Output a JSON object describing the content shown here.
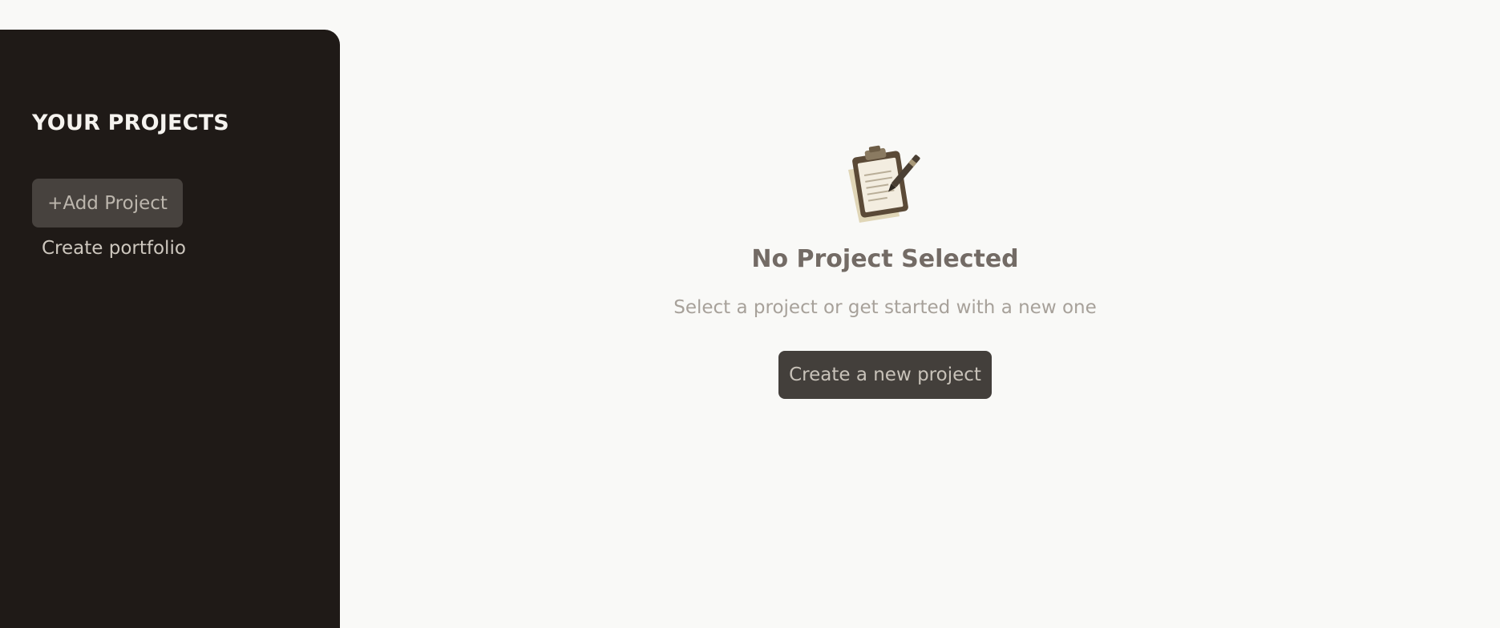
{
  "sidebar": {
    "title": "YOUR PROJECTS",
    "add_project_label": "+Add Project",
    "create_portfolio_label": "Create portfolio"
  },
  "main": {
    "empty_state": {
      "icon": "clipboard-icon",
      "title": "No Project Selected",
      "subtitle": "Select a project or get started with a new one",
      "button_label": "Create a new project"
    }
  },
  "colors": {
    "sidebar_bg": "#1f1a17",
    "page_bg": "#f9f9f7",
    "button_bg": "#433f3b",
    "title_text": "#736b65"
  }
}
